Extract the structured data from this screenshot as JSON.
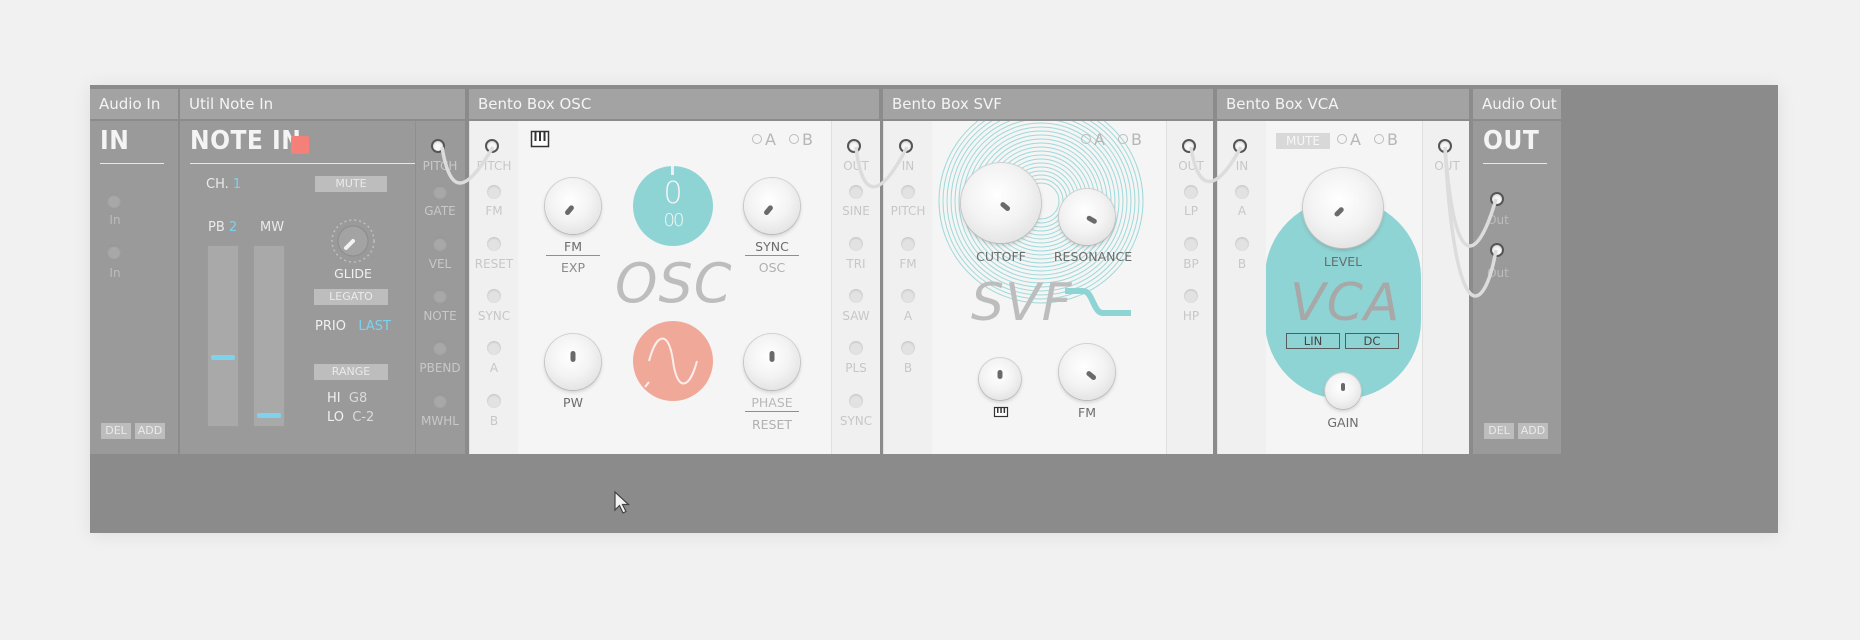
{
  "modules": {
    "audio_in": {
      "tab": "Audio In",
      "title": "IN",
      "jacks": [
        "In",
        "In"
      ],
      "del": "DEL",
      "add": "ADD"
    },
    "note_in": {
      "tab": "Util Note In",
      "title": "NOTE IN",
      "ch_label": "CH.",
      "ch_value": "1",
      "mute": "MUTE",
      "pb_label": "PB",
      "pb_value": "2",
      "mw_label": "MW",
      "pb_level": 0.38,
      "mw_level": 0.04,
      "glide": "GLIDE",
      "legato": "LEGATO",
      "prio_label": "PRIO",
      "prio_value": "LAST",
      "range": "RANGE",
      "hi_label": "HI",
      "hi_value": "G8",
      "lo_label": "LO",
      "lo_value": "C-2",
      "outs": [
        "PITCH",
        "GATE",
        "VEL",
        "NOTE",
        "PBEND",
        "MWHL"
      ]
    },
    "osc": {
      "tab": "Bento Box OSC",
      "inputs": [
        "PITCH",
        "FM",
        "RESET",
        "SYNC",
        "A",
        "B"
      ],
      "outputs": [
        "OUT",
        "SINE",
        "TRI",
        "SAW",
        "PLS",
        "SYNC"
      ],
      "a": "A",
      "b": "B",
      "fm": "FM",
      "exp": "EXP",
      "sync": "SYNC",
      "osc_mode": "OSC",
      "octave": "0",
      "octave_sub": "00",
      "pw": "PW",
      "phase": "PHASE",
      "reset": "RESET",
      "watermark": "OSC"
    },
    "svf": {
      "tab": "Bento Box SVF",
      "inputs": [
        "IN",
        "PITCH",
        "FM",
        "A",
        "B"
      ],
      "outputs": [
        "OUT",
        "LP",
        "BP",
        "HP"
      ],
      "a": "A",
      "b": "B",
      "cutoff": "CUTOFF",
      "resonance": "RESONANCE",
      "fm": "FM",
      "watermark": "SVF"
    },
    "vca": {
      "tab": "Bento Box VCA",
      "inputs": [
        "IN",
        "A",
        "B"
      ],
      "outputs": [
        "OUT"
      ],
      "mute": "MUTE",
      "a": "A",
      "b": "B",
      "level": "LEVEL",
      "lin": "LIN",
      "dc": "DC",
      "gain": "GAIN",
      "watermark": "VCA"
    },
    "audio_out": {
      "tab": "Audio Out",
      "title": "OUT",
      "jacks": [
        "Out",
        "Out"
      ],
      "del": "DEL",
      "add": "ADD"
    }
  },
  "colors": {
    "accent_teal": "#8fd4d4",
    "accent_salmon": "#f0a898",
    "accent_blue": "#7dd3ee",
    "rack": "#8b8b8c",
    "note_led": "#f3817a"
  },
  "icons": {
    "keyboard": "keyboard-icon",
    "cursor": "mouse-cursor-icon",
    "sine": "sine-wave-icon"
  }
}
